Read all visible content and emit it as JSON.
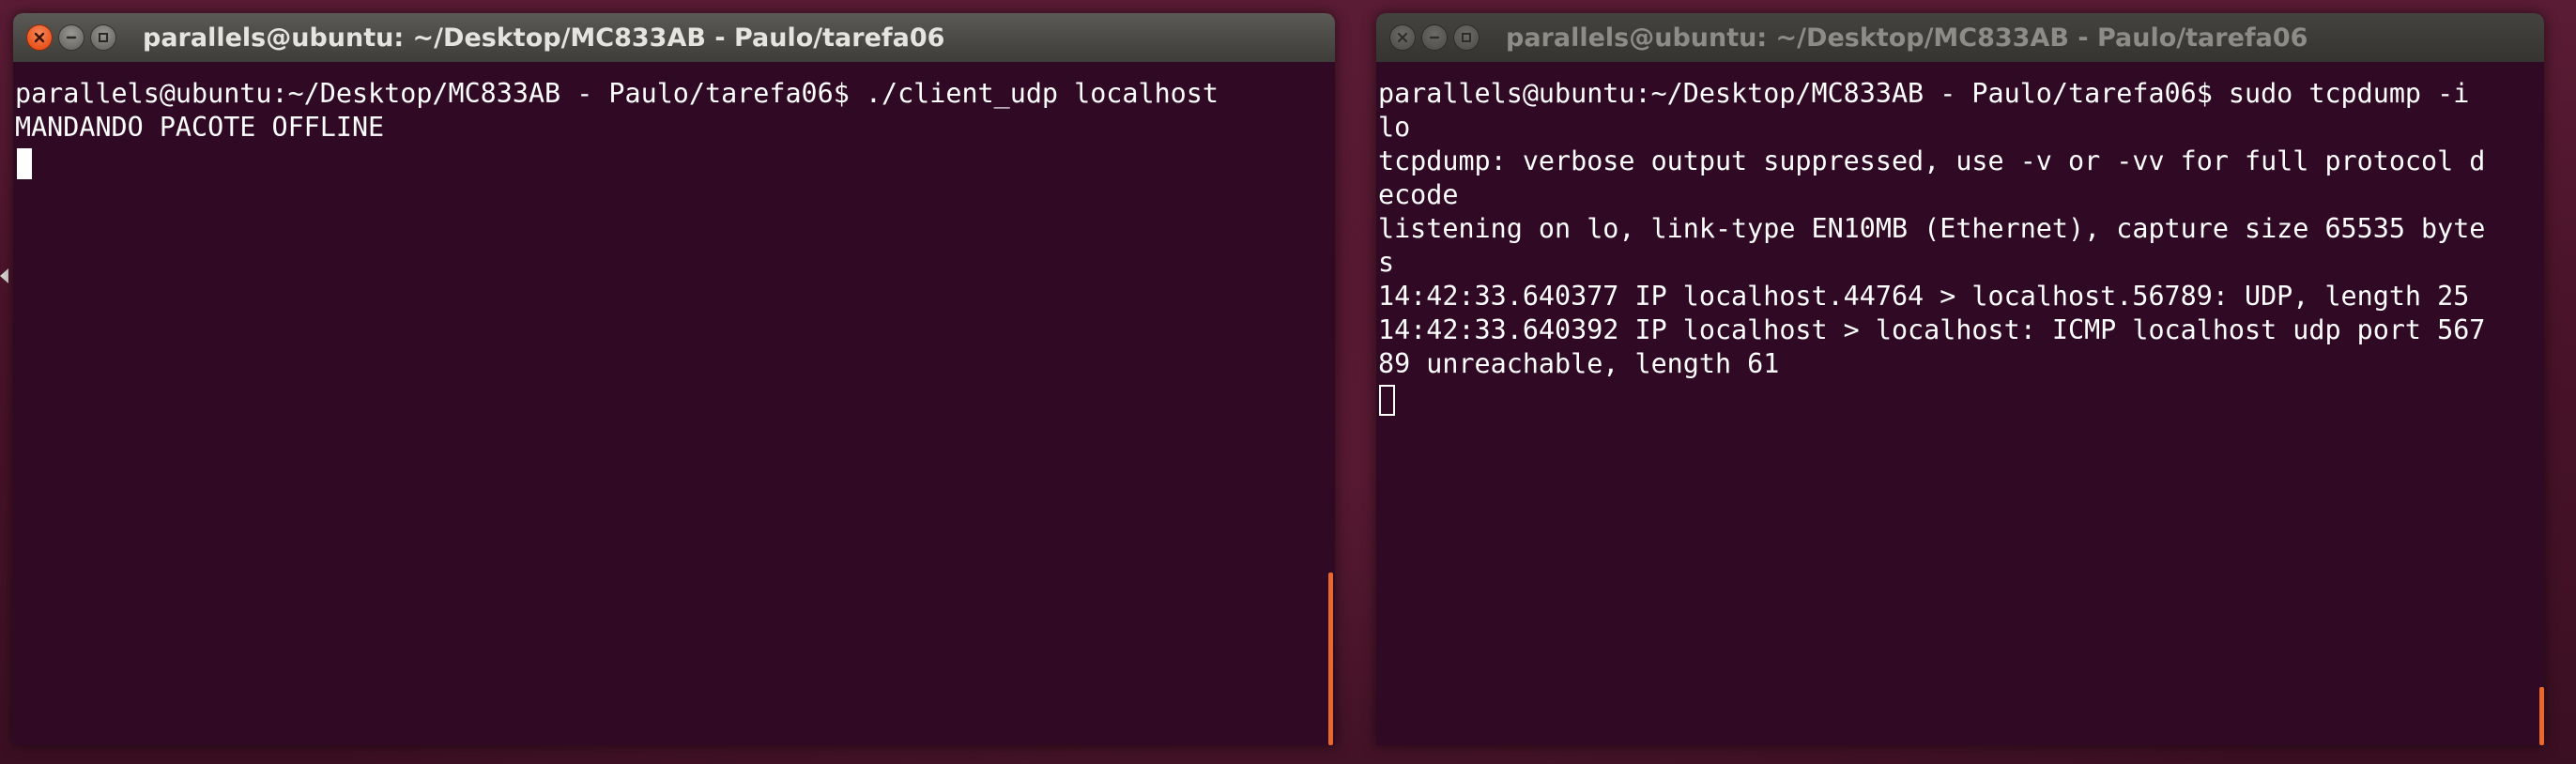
{
  "windows": {
    "left": {
      "title": "parallels@ubuntu: ~/Desktop/MC833AB - Paulo/tarefa06",
      "state": "active",
      "lines": [
        "parallels@ubuntu:~/Desktop/MC833AB - Paulo/tarefa06$ ./client_udp localhost",
        "MANDANDO PACOTE OFFLINE"
      ]
    },
    "right": {
      "title": "parallels@ubuntu: ~/Desktop/MC833AB - Paulo/tarefa06",
      "state": "inactive",
      "lines": [
        "parallels@ubuntu:~/Desktop/MC833AB - Paulo/tarefa06$ sudo tcpdump -i",
        "lo",
        "tcpdump: verbose output suppressed, use -v or -vv for full protocol d",
        "ecode",
        "listening on lo, link-type EN10MB (Ethernet), capture size 65535 byte",
        "s",
        "14:42:33.640377 IP localhost.44764 > localhost.56789: UDP, length 25",
        "14:42:33.640392 IP localhost > localhost: ICMP localhost udp port 567",
        "89 unreachable, length 61"
      ]
    }
  },
  "icons": {
    "close": "close-icon",
    "minimize": "minimize-icon",
    "maximize": "maximize-icon"
  },
  "colors": {
    "terminal_bg": "#300a24",
    "terminal_fg": "#ffffff",
    "close_button": "#e9541e",
    "scroll_indicator": "#e9692c"
  }
}
